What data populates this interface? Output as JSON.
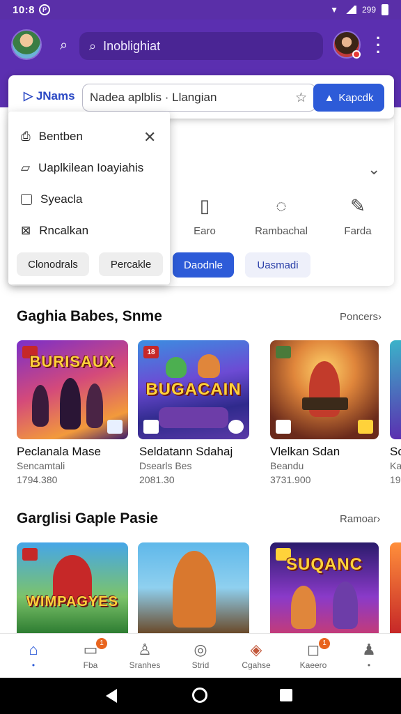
{
  "status": {
    "time": "10:8",
    "right_text": "299"
  },
  "appbar": {
    "search_text": "Inoblighiat"
  },
  "searchbar": {
    "brand": "JNams",
    "query": "Nadea aplblis · Llangian",
    "button_label": "Kapcdk"
  },
  "dropdown": {
    "items": [
      {
        "label": "Bentben"
      },
      {
        "label": "Uaplkilean Ioayiahis"
      },
      {
        "label": "Syeacla"
      },
      {
        "label": "Rncalkan"
      }
    ],
    "pills": [
      "Clonodrals",
      "Percakle"
    ]
  },
  "categories": [
    {
      "label": "Earo",
      "icon": "book-icon"
    },
    {
      "label": "Rambachal",
      "icon": "chat-icon"
    },
    {
      "label": "Farda",
      "icon": "microphone-icon"
    }
  ],
  "filters": [
    {
      "label": "Daodnle",
      "active": true
    },
    {
      "label": "Uasmadi",
      "active": false
    }
  ],
  "sections": [
    {
      "title": "Gaghia Babes, Snme",
      "link": "Poncers",
      "games": [
        {
          "art": "BURISAUX",
          "name": "Peclanala Mase",
          "sub": "Sencamtali",
          "num": "1794.380"
        },
        {
          "art": "BUGACAIN",
          "name": "Seldatann Sdahaj",
          "sub": "Dsearls Bes",
          "num": "2081.30"
        },
        {
          "art": "",
          "name": "Vlelkan Sdan",
          "sub": "Beandu",
          "num": "3731.900"
        },
        {
          "art": "",
          "name": "Sc",
          "sub": "Ka",
          "num": "19"
        }
      ]
    },
    {
      "title": "Garglisi Gaple Pasie",
      "link": "Ramoar",
      "games": [
        {
          "art": "WIMPAGYES"
        },
        {
          "art": ""
        },
        {
          "art": "SUQANC"
        },
        {
          "art": ""
        }
      ]
    }
  ],
  "bottomnav": [
    {
      "label": "",
      "icon": "home-icon",
      "active": true
    },
    {
      "label": "Fba",
      "icon": "inbox-icon",
      "badge": "1"
    },
    {
      "label": "Sranhes",
      "icon": "profile-icon"
    },
    {
      "label": "Strid",
      "icon": "download-icon"
    },
    {
      "label": "Cgahse",
      "icon": "tag-icon"
    },
    {
      "label": "Kaeero",
      "icon": "message-icon",
      "badge": "1"
    },
    {
      "label": "",
      "icon": "account-icon"
    }
  ]
}
